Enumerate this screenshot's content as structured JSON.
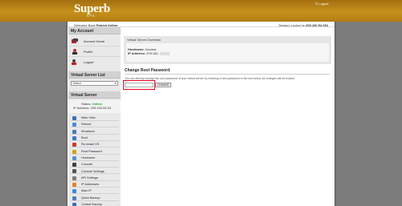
{
  "header": {
    "logo_main": "Superb",
    "logo_sub": "VPS",
    "logout_label": "Logout"
  },
  "welcome": {
    "prefix": "Welcome Back",
    "user": "Patrick Kelber",
    "session_prefix": "Session Locked to",
    "session_ip": "209.160.54.254"
  },
  "sidebar": {
    "account_heading": "My Account",
    "account_items": [
      {
        "label": "Account Home",
        "icon": "account-home-icon"
      },
      {
        "label": "Profile",
        "icon": "profile-icon"
      },
      {
        "label": "Logout",
        "icon": "logout-icon"
      }
    ],
    "server_list_heading": "Virtual Server List",
    "select_value": "Select",
    "virtual_server_heading": "Virtual Server",
    "status_label": "Status:",
    "status_value": "Online",
    "ip_label": "IP Address:",
    "ip_value": "209.160.53.53",
    "menu": [
      {
        "label": "Main View",
        "color": "#3a6fb5"
      },
      {
        "label": "Reboot",
        "color": "#4a8ad6"
      },
      {
        "label": "Shutdown",
        "color": "#4a7fb0"
      },
      {
        "label": "Boot",
        "color": "#3c78c8"
      },
      {
        "label": "Re-install OS",
        "color": "#c83a2a"
      },
      {
        "label": "Root Password",
        "color": "#d0a020"
      },
      {
        "label": "Hostname",
        "color": "#5a8fc8"
      },
      {
        "label": "Console",
        "color": "#404040"
      },
      {
        "label": "Console Settings",
        "color": "#555555"
      },
      {
        "label": "API Settings",
        "color": "#7a7a7a"
      },
      {
        "label": "IP Addresses",
        "color": "#e8801c"
      },
      {
        "label": "Main IP",
        "color": "#3a8ad6"
      },
      {
        "label": "Quick Backup",
        "color": "#4a80c0"
      },
      {
        "label": "Central Backup",
        "color": "#3a70b0"
      }
    ]
  },
  "overview": {
    "title": "Virtual Server Overview",
    "hostname_label": "Hostname:",
    "hostname_value": "Nuclear",
    "ip_label": "IP Address:",
    "ip_value": "209.160."
  },
  "change_root": {
    "title": "Change Root Password",
    "description": "You can directly change the root password of your virtual server by entering a new password in the box below. All changes will be instant.",
    "password_placeholder": "",
    "button_label": "CHANGE"
  }
}
